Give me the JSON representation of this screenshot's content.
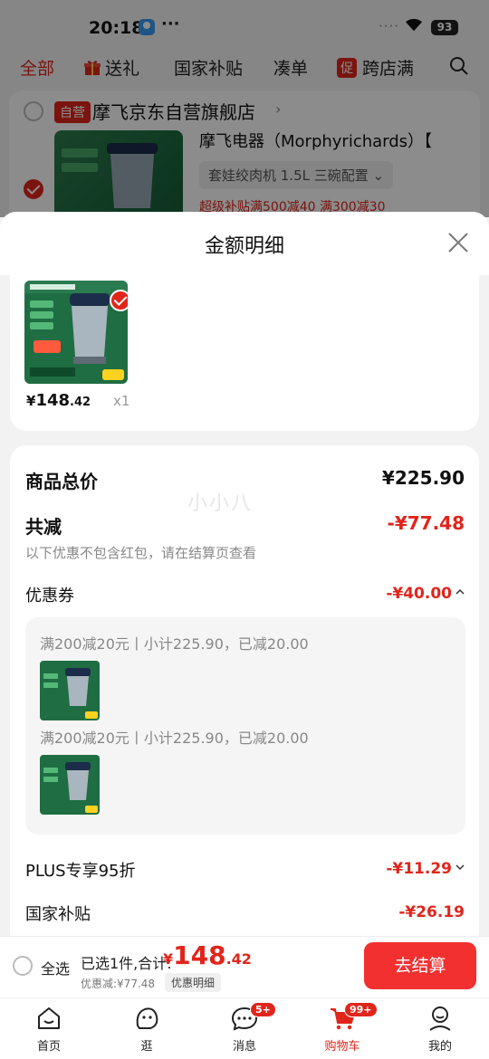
{
  "status_bar": {
    "time": "20:18",
    "dots": "···",
    "signal": "····",
    "battery": "93"
  },
  "top_tabs": [
    {
      "label": "全部"
    },
    {
      "label": "送礼"
    },
    {
      "label": "国家补贴"
    },
    {
      "label": "凑单"
    },
    {
      "badge": "促",
      "label": "跨店满"
    }
  ],
  "shop": {
    "badge": "自营",
    "name": "摩飞京东自营旗舰店",
    "item_title": "摩飞电器（Morphyrichards）【",
    "item_spec": "套娃绞肉机 1.5L 三碗配置",
    "item_promo": "超级补贴满500减40  满300减30"
  },
  "sheet": {
    "title": "金额明细",
    "watermark": "小小八",
    "product": {
      "yuan": "¥",
      "int": "148",
      "dec": ".42",
      "qty": "x1"
    },
    "goods_total": {
      "label": "商品总价",
      "value": "¥225.90"
    },
    "total_discount": {
      "label": "共减",
      "value": "-¥77.48",
      "note": "以下优惠不包含红包，请在结算页查看"
    },
    "coupon": {
      "label": "优惠券",
      "value": "-¥40.00",
      "lines": [
        {
          "text": "满200减20元丨小计225.90，已减20.00"
        },
        {
          "text": "满200减20元丨小计225.90，已减20.00"
        }
      ]
    },
    "plus": {
      "label": "PLUS专享95折",
      "value": "-¥11.29"
    },
    "subsidy": {
      "label": "国家补贴",
      "value": "-¥26.19"
    }
  },
  "checkout": {
    "select_all": "全选",
    "summary": "已选1件,合计:",
    "yuan": "¥",
    "int": "148",
    "dec": ".42",
    "discount": "优惠减:¥77.48",
    "detail_button": "优惠明细",
    "checkout_button": "去结算"
  },
  "bottom_nav": [
    {
      "label": "首页",
      "icon": "home-icon"
    },
    {
      "label": "逛",
      "icon": "browse-icon"
    },
    {
      "label": "消息",
      "icon": "message-icon",
      "badge": "5+"
    },
    {
      "label": "购物车",
      "icon": "cart-icon",
      "badge": "99+",
      "active": true
    },
    {
      "label": "我的",
      "icon": "profile-icon"
    }
  ],
  "colors": {
    "accent": "#e1251b",
    "checkout_button": "#f23030",
    "background": "#f2f2f2"
  }
}
